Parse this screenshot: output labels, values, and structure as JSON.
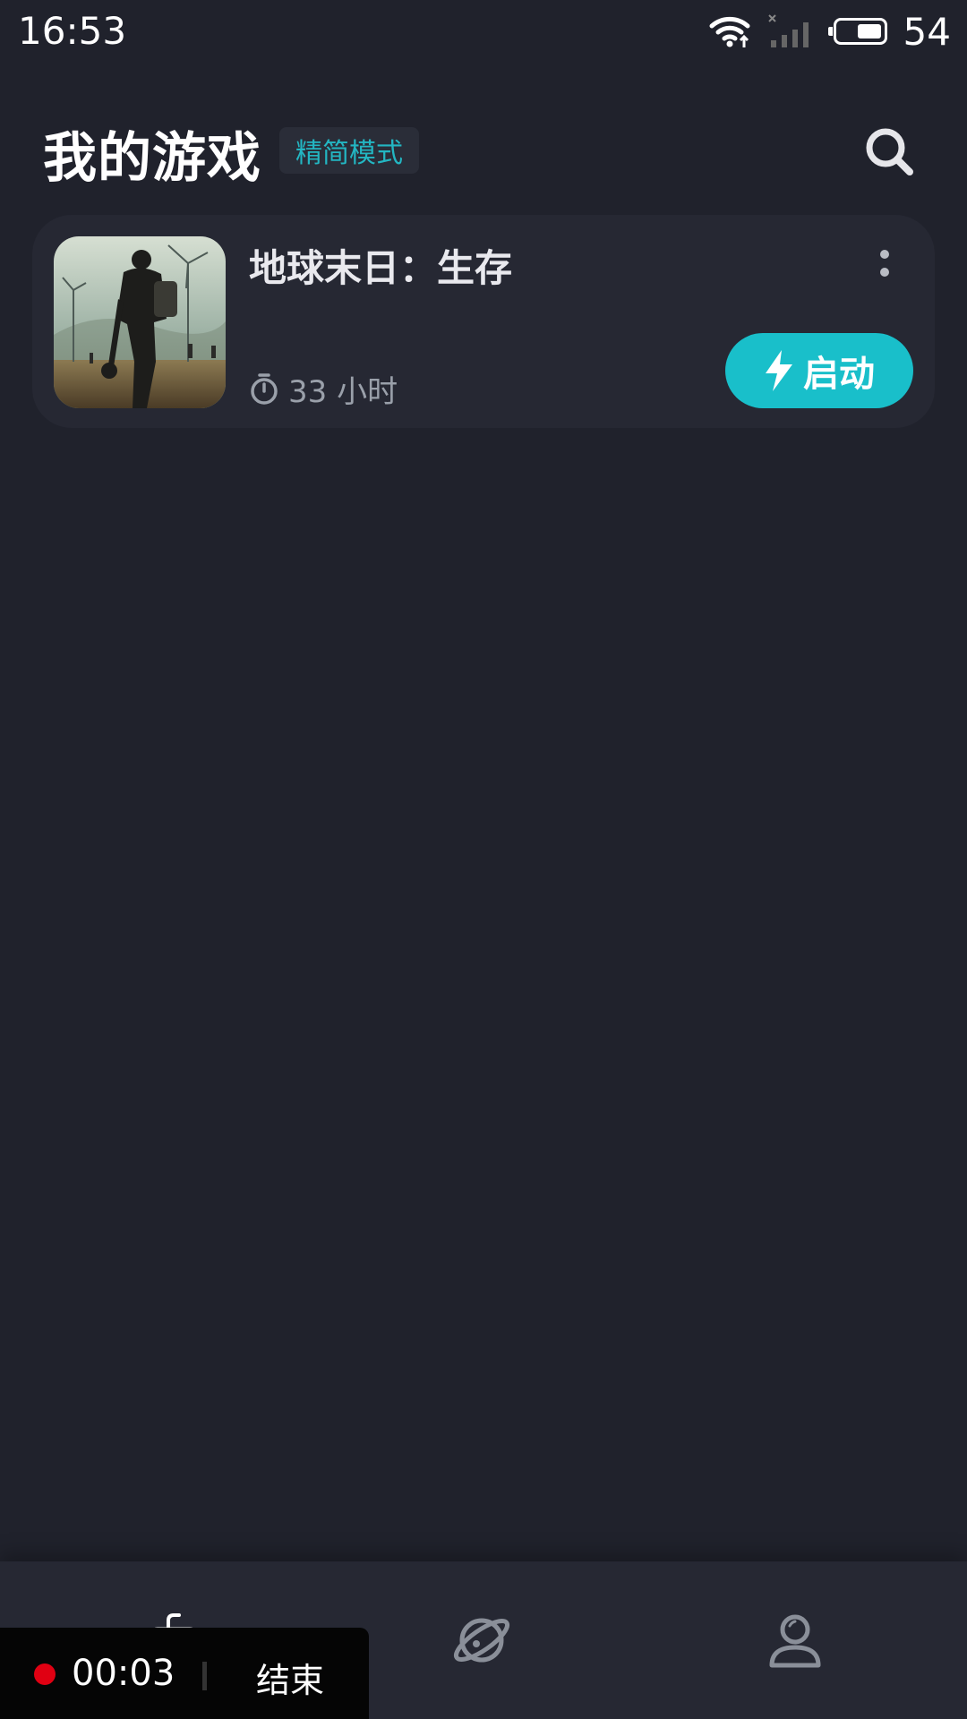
{
  "status_bar": {
    "time": "16:53",
    "battery_percent": "54",
    "icons": [
      "wifi-icon",
      "signal-off-icon",
      "battery-icon"
    ]
  },
  "header": {
    "title": "我的游戏",
    "mode_badge": "精简模式",
    "search_icon": "search-icon"
  },
  "games": [
    {
      "title": "地球末日：生存",
      "playtime": "33 小时",
      "launch_label": "启动",
      "more_icon": "more-vertical-icon"
    }
  ],
  "bottom_nav": {
    "items": [
      "gamepad-icon",
      "planet-icon",
      "user-icon"
    ],
    "active_color": "#ffffff",
    "inactive_color": "#8a8f99"
  },
  "recording": {
    "elapsed": "00:03",
    "end_label": "结束"
  },
  "colors": {
    "background": "#20222c",
    "card": "#262833",
    "accent": "#19bfca"
  }
}
